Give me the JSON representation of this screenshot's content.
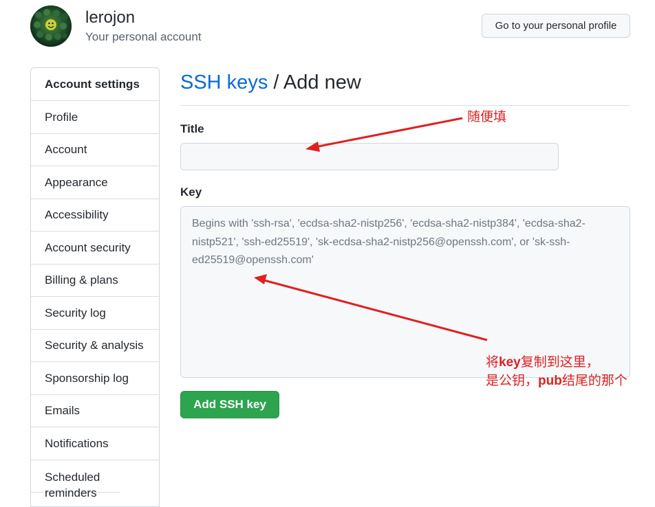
{
  "header": {
    "username": "lerojon",
    "account_type": "Your personal account",
    "profile_button": "Go to your personal profile"
  },
  "sidebar": {
    "heading": "Account settings",
    "items": [
      {
        "label": "Profile"
      },
      {
        "label": "Account"
      },
      {
        "label": "Appearance"
      },
      {
        "label": "Accessibility"
      },
      {
        "label": "Account security"
      },
      {
        "label": "Billing & plans"
      },
      {
        "label": "Security log"
      },
      {
        "label": "Security & analysis"
      },
      {
        "label": "Sponsorship log"
      },
      {
        "label": "Emails"
      },
      {
        "label": "Notifications"
      },
      {
        "label": "Scheduled reminders"
      }
    ]
  },
  "main": {
    "breadcrumb_link": "SSH keys",
    "breadcrumb_sep": " / ",
    "breadcrumb_current": "Add new",
    "title_label": "Title",
    "title_value": "",
    "key_label": "Key",
    "key_value": "",
    "key_placeholder": "Begins with 'ssh-rsa', 'ecdsa-sha2-nistp256', 'ecdsa-sha2-nistp384', 'ecdsa-sha2-nistp521', 'ssh-ed25519', 'sk-ecdsa-sha2-nistp256@openssh.com', or 'sk-ssh-ed25519@openssh.com'",
    "submit_button": "Add SSH key"
  },
  "annotations": {
    "title_note": "随便填",
    "key_note_line1_prefix": "将",
    "key_note_line1_bold": "key",
    "key_note_line1_suffix": "复制到这里，",
    "key_note_line2_prefix": "是公钥，",
    "key_note_line2_bold": "pub",
    "key_note_line2_suffix": "结尾的那个",
    "color": "#e02020"
  },
  "colors": {
    "link": "#0969da",
    "primary_button": "#2da44e",
    "input_bg": "#f6f8fa"
  }
}
